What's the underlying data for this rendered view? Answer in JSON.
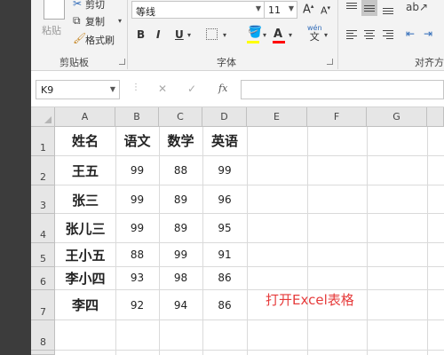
{
  "ribbon": {
    "clipboard": {
      "paste_label": "粘贴",
      "cut_label": "剪切",
      "copy_label": "复制",
      "format_painter_label": "格式刷",
      "group_label": "剪贴板"
    },
    "font": {
      "font_name": "等线",
      "font_size": "11",
      "increase_size": "A",
      "decrease_size": "A",
      "bold": "B",
      "italic": "I",
      "underline": "U",
      "phonetic": "wén",
      "phonetic_sub": "文",
      "group_label": "字体",
      "highlight_color": "#ffff00",
      "font_color": "#ff0000"
    },
    "alignment": {
      "group_label": "对齐方"
    }
  },
  "formula_bar": {
    "name_box": "K9",
    "cancel_icon": "✕",
    "enter_icon": "✓",
    "fx_label": "fx",
    "formula": ""
  },
  "sheet": {
    "columns": [
      "A",
      "B",
      "C",
      "D",
      "E",
      "F",
      "G"
    ],
    "rows": [
      "1",
      "2",
      "3",
      "4",
      "5",
      "6",
      "7",
      "8"
    ],
    "header": [
      "姓名",
      "语文",
      "数学",
      "英语"
    ],
    "data": [
      [
        "王五",
        "99",
        "88",
        "99"
      ],
      [
        "张三",
        "99",
        "89",
        "96"
      ],
      [
        "张儿三",
        "99",
        "89",
        "95"
      ],
      [
        "王小五",
        "88",
        "99",
        "91"
      ],
      [
        "李小四",
        "93",
        "98",
        "86"
      ],
      [
        "李四",
        "92",
        "94",
        "86"
      ]
    ],
    "note": "打开Excel表格",
    "note_color": "#e63b3b"
  }
}
